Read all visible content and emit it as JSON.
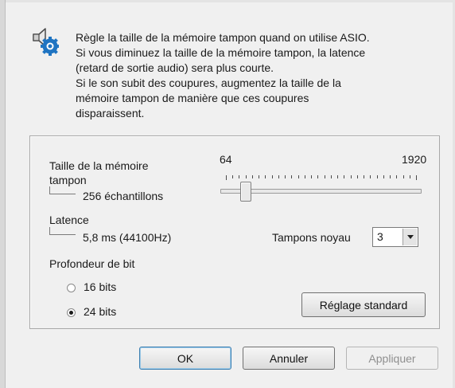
{
  "info": {
    "lines": [
      "Règle la taille de la mémoire tampon quand on utilise ASIO.",
      "Si vous diminuez la taille de la mémoire tampon, la latence",
      "(retard de sortie audio) sera plus courte.",
      "Si le son subit des coupures, augmentez la taille de la",
      "mémoire tampon de manière que ces coupures",
      "disparaissent."
    ],
    "icon": "speaker-gear-icon"
  },
  "buffer": {
    "label_line1": "Taille de la mémoire",
    "label_line2": "tampon",
    "value": "256 échantillons",
    "slider_min": "64",
    "slider_max": "1920",
    "slider_fraction": 0.1
  },
  "latency": {
    "label": "Latence",
    "value": "5,8 ms (44100Hz)"
  },
  "core_buffers": {
    "label": "Tampons noyau",
    "value": "3"
  },
  "bit_depth": {
    "label": "Profondeur de bit",
    "options": [
      {
        "label": "16 bits",
        "checked": false
      },
      {
        "label": "24 bits",
        "checked": true
      }
    ]
  },
  "buttons": {
    "standard": "Réglage standard",
    "ok": "OK",
    "cancel": "Annuler",
    "apply": "Appliquer"
  },
  "colors": {
    "accent": "#1f74c2",
    "dialog_bg": "#f0f0f0"
  }
}
